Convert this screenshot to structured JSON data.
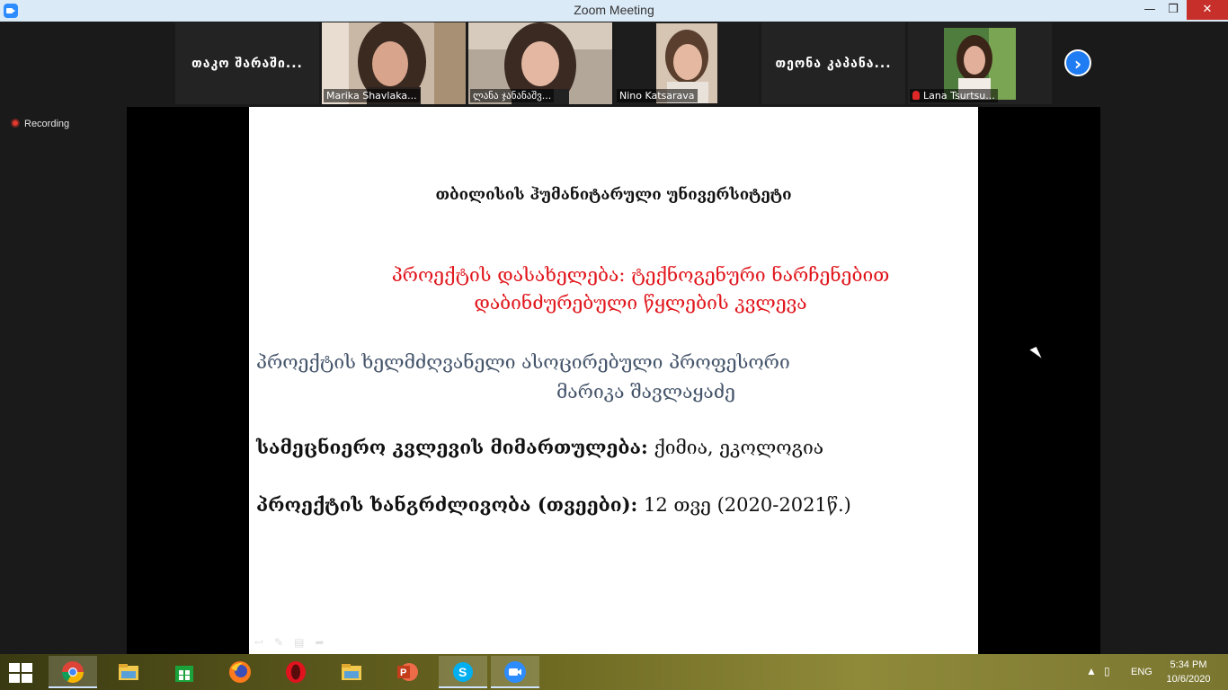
{
  "window": {
    "title": "Zoom Meeting",
    "controls": {
      "minimize": "—",
      "maximize": "❒",
      "close": "✕"
    }
  },
  "participants": [
    {
      "name": "თაკო შარაში...",
      "video": false
    },
    {
      "label": "Marika Shavlaka...",
      "video": true
    },
    {
      "label": "ლანა ჯანანაშვ...",
      "video": true
    },
    {
      "label": "Nino Katsarava",
      "video": true,
      "active": true
    },
    {
      "name": "თეონა კაპანა...",
      "video": false
    },
    {
      "label": "Lana Tsurtsu...",
      "video": true,
      "muted": true
    }
  ],
  "recording": {
    "label": "Recording"
  },
  "slide": {
    "university": "თბილისის ჰუმანიტარული უნივერსიტეტი",
    "title_line1": "პროექტის დასახელება:  ტექნოგენური ნარჩენებით",
    "title_line2": "დაბინძურებული წყლების კვლევა",
    "leader_line1": "პროექტის ხელმძღვანელი  ასოცირებული პროფესორი",
    "leader_line2": "მარიკა შავლაყაძე",
    "field_label": "სამეცნიერო კვლევის მიმართულება:",
    "field_value": " ქიმია, ეკოლოგია",
    "duration_label": "პროექტის ხანგრძლივობა (თვეები):",
    "duration_value": "   12 თვე (2020-2021წ.)"
  },
  "taskbar": {
    "apps": [
      "chrome",
      "file-explorer",
      "store",
      "firefox",
      "opera",
      "file-explorer",
      "powerpoint",
      "skype",
      "zoom"
    ],
    "language": "ENG",
    "time": "5:34 PM",
    "date": "10/6/2020"
  },
  "colors": {
    "accent": "#2d8cff",
    "slide_title": "#e0161c",
    "slide_leader": "#44546a",
    "active_speaker": "#7dd84a"
  }
}
